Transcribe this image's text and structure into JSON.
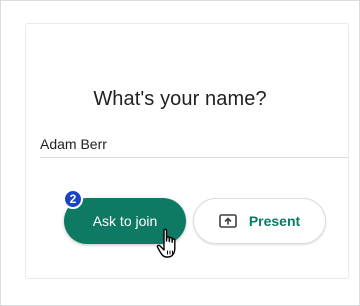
{
  "dialog": {
    "title": "What's your name?",
    "name_value": "Adam Berr"
  },
  "actions": {
    "ask_label": "Ask to join",
    "present_label": "Present"
  },
  "annotation": {
    "step": "2"
  },
  "icons": {
    "present": "present-screen-icon",
    "cursor": "hand-pointer-icon"
  },
  "colors": {
    "accent": "#0f7a64",
    "badge": "#1a43c8",
    "text": "#202124",
    "divider": "#dadce0"
  }
}
